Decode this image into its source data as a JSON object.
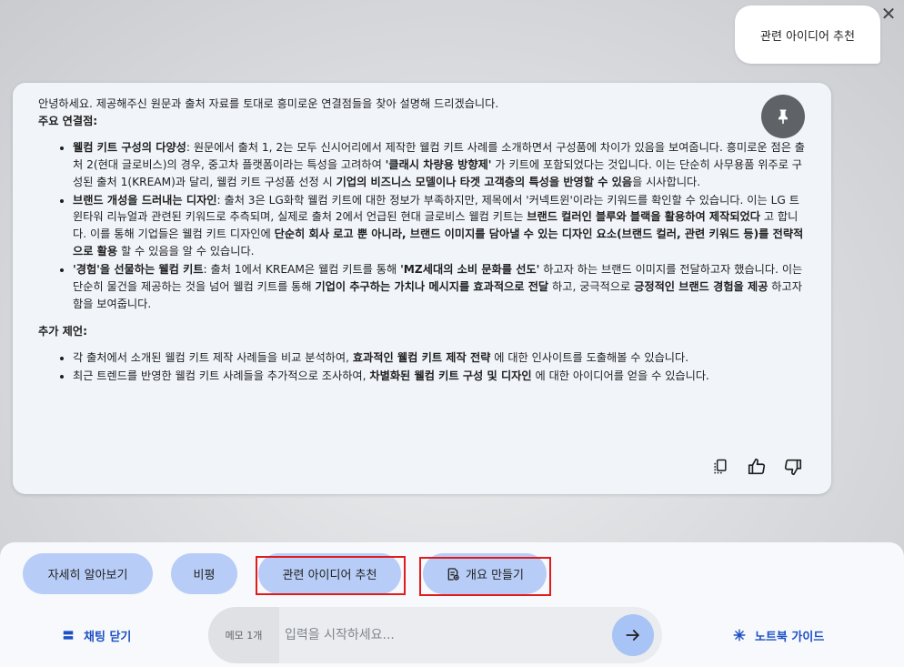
{
  "user_message": "관련 아이디어 추천",
  "response": {
    "intro": "안녕하세요. 제공해주신 원문과 출처 자료를 토대로 흥미로운 연결점들을 찾아 설명해 드리겠습니다.",
    "section1_title": "주요 연결점:",
    "points": [
      [
        {
          "t": "웰컴 키트 구성의 다양성",
          "b": true
        },
        {
          "t": ": 원문에서 출처 1, 2는 모두 신시어리에서 제작한 웰컴 키트 사례를 소개하면서 구성품에 차이가 있음을 보여줍니다. 흥미로운 점은 출처 2(현대 글로비스)의 경우, 중고차 플랫폼이라는 특성을 고려하여 "
        },
        {
          "t": "'클래시 차량용 방향제'",
          "b": true
        },
        {
          "t": " 가 키트에 포함되었다는 것입니다. 이는 단순히 사무용품 위주로 구성된 출처 1(KREAM)과 달리, 웰컴 키트 구성품 선정 시 "
        },
        {
          "t": "기업의 비즈니스 모델이나 타겟 고객층의 특성을 반영할 수 있음",
          "b": true
        },
        {
          "t": "을 시사합니다."
        }
      ],
      [
        {
          "t": "브랜드 개성을 드러내는 디자인",
          "b": true
        },
        {
          "t": ": 출처 3은 LG화학 웰컴 키트에 대한 정보가 부족하지만, 제목에서 '커넥트윈'이라는 키워드를 확인할 수 있습니다. 이는 LG 트윈타워 리뉴얼과 관련된 키워드로 추측되며, 실제로 출처 2에서 언급된 현대 글로비스 웰컴 키트는 "
        },
        {
          "t": "브랜드 컬러인 블루와 블랙을 활용하여 제작되었다",
          "b": true
        },
        {
          "t": " 고 합니다. 이를 통해 기업들은 웰컴 키트 디자인에 "
        },
        {
          "t": "단순히 회사 로고 뿐 아니라, 브랜드 이미지를 담아낼 수 있는 디자인 요소(브랜드 컬러, 관련 키워드 등)를 전략적으로 활용",
          "b": true
        },
        {
          "t": " 할 수 있음을 알 수 있습니다."
        }
      ],
      [
        {
          "t": "'경험'을 선물하는 웰컴 키트",
          "b": true
        },
        {
          "t": ": 출처 1에서 KREAM은 웰컴 키트를 통해 "
        },
        {
          "t": "'MZ세대의 소비 문화를 선도'",
          "b": true
        },
        {
          "t": " 하고자 하는 브랜드 이미지를 전달하고자 했습니다. 이는 단순히 물건을 제공하는 것을 넘어 웰컴 키트를 통해 "
        },
        {
          "t": "기업이 추구하는 가치나 메시지를 효과적으로 전달",
          "b": true
        },
        {
          "t": " 하고, 궁극적으로 "
        },
        {
          "t": "긍정적인 브랜드 경험을 제공",
          "b": true
        },
        {
          "t": " 하고자 함을 보여줍니다."
        }
      ]
    ],
    "section2_title": "추가 제언:",
    "suggestions": [
      [
        {
          "t": "각 출처에서 소개된 웰컴 키트 제작 사례들을 비교 분석하여, "
        },
        {
          "t": "효과적인 웰컴 키트 제작 전략",
          "b": true
        },
        {
          "t": " 에 대한 인사이트를 도출해볼 수 있습니다."
        }
      ],
      [
        {
          "t": "최근 트렌드를 반영한 웰컴 키트 사례들을 추가적으로 조사하여, "
        },
        {
          "t": "차별화된 웰컴 키트 구성 및 디자인",
          "b": true
        },
        {
          "t": " 에 대한 아이디어를 얻을 수 있습니다."
        }
      ]
    ]
  },
  "chips": {
    "learn_more": "자세히 알아보기",
    "critique": "비평",
    "related_ideas": "관련 아이디어 추천",
    "outline": "개요 만들기"
  },
  "footer": {
    "close_chat": "채팅 닫기",
    "memo_count": "메모 1개",
    "input_placeholder": "입력을 시작하세요...",
    "notebook_guide": "노트북 가이드"
  },
  "colors": {
    "chip_bg": "#b7cdf7",
    "accent": "#1d4fc4",
    "highlight": "#e21b1b"
  }
}
